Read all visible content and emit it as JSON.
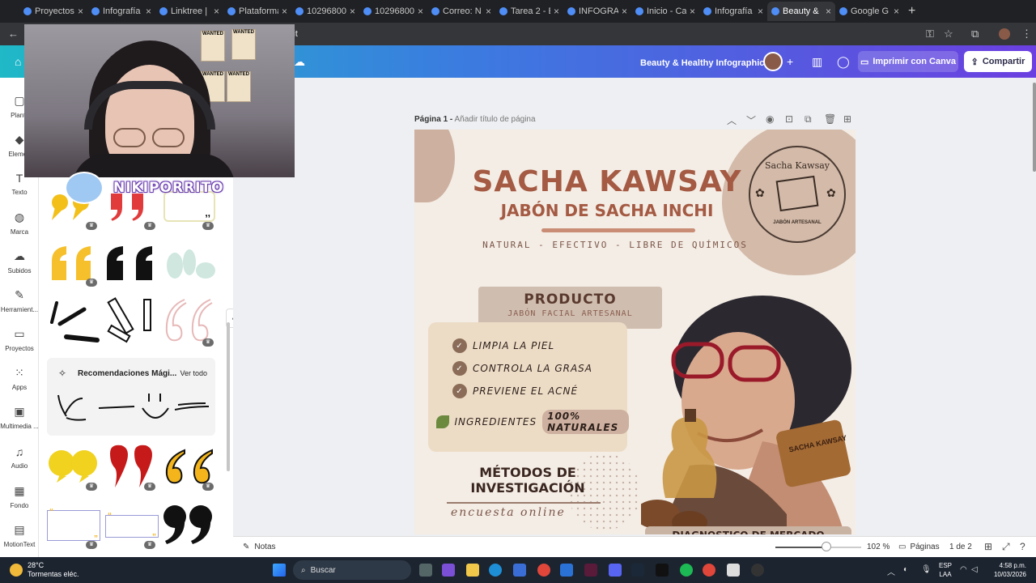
{
  "browser": {
    "tabs": [
      {
        "title": "Proyectos",
        "active": false
      },
      {
        "title": "Infografía",
        "active": false
      },
      {
        "title": "Linktree | E",
        "active": false
      },
      {
        "title": "Plataforma",
        "active": false
      },
      {
        "title": "10296800",
        "active": false
      },
      {
        "title": "10296800",
        "active": false
      },
      {
        "title": "Correo: N",
        "active": false
      },
      {
        "title": "Tarea 2 - E",
        "active": false
      },
      {
        "title": "INFOGRA",
        "active": false
      },
      {
        "title": "Inicio - Ca",
        "active": false
      },
      {
        "title": "Infografía",
        "active": false
      },
      {
        "title": "Beauty &",
        "active": true
      },
      {
        "title": "Google G",
        "active": false
      }
    ],
    "url_fragment": "lit"
  },
  "header": {
    "doc_title": "Beauty & Healthy Infographic",
    "print_label": "Imprimir con Canva",
    "share_label": "Compartir"
  },
  "rail": {
    "items": [
      {
        "label": "Plantil",
        "icon": "template-icon"
      },
      {
        "label": "Elemen",
        "icon": "elements-icon"
      },
      {
        "label": "Texto",
        "icon": "text-icon"
      },
      {
        "label": "Marca",
        "icon": "brand-icon"
      },
      {
        "label": "Subidos",
        "icon": "upload-icon"
      },
      {
        "label": "Herramient...",
        "icon": "tools-icon"
      },
      {
        "label": "Proyectos",
        "icon": "folder-icon"
      },
      {
        "label": "Apps",
        "icon": "apps-icon"
      },
      {
        "label": "Multimedia ...",
        "icon": "media-icon"
      },
      {
        "label": "Audio",
        "icon": "music-icon"
      },
      {
        "label": "Fondo",
        "icon": "background-icon"
      },
      {
        "label": "MotionText",
        "icon": "motiontext-icon"
      }
    ]
  },
  "panel": {
    "rec_title": "Recomendaciones Mági...",
    "rec_all": "Ver todo"
  },
  "page": {
    "label_bold": "Página 1 -",
    "label_placeholder": "Añadir título de página"
  },
  "design": {
    "title": "SACHA KAWSAY",
    "subtitle": "JABÓN DE SACHA INCHI",
    "tagline": "NATURAL - EFECTIVO - LIBRE DE QUÍMICOS",
    "logo_top": "Sacha Kawsay",
    "logo_bottom": "JABÓN ARTESANAL",
    "product_title": "PRODUCTO",
    "product_sub": "JABÓN FACIAL ARTESANAL",
    "benefits": [
      "LIMPIA LA PIEL",
      "CONTROLA LA GRASA",
      "PREVIENE EL ACNÉ"
    ],
    "ingredients_prefix": "INGREDIENTES",
    "ingredients_highlight": "100% NATURALES",
    "methods_line1": "MÉTODOS DE",
    "methods_line2": "INVESTIGACIÓN",
    "survey": "encuesta online",
    "diagnosis": "DIAGNOSTICO DE MERCADO",
    "soap_text": "SACHA KAWSAY"
  },
  "bottom": {
    "notes": "Notas",
    "zoom": "102 %",
    "pages_label": "Páginas",
    "page_count": "1 de 2"
  },
  "taskbar": {
    "temp": "28°C",
    "weather": "Tormentas eléc.",
    "search": "Buscar",
    "lang1": "ESP",
    "lang2": "LAA",
    "time": "4:58 p.m.",
    "date": "10/03/2026"
  },
  "stream": {
    "name": "NIKIPORRITO",
    "poster_text": "WANTED"
  },
  "colors": {
    "accent_brown": "#a45a43",
    "canva_gradient_start": "#1fb9c7",
    "canva_gradient_end": "#6b3fe0"
  }
}
